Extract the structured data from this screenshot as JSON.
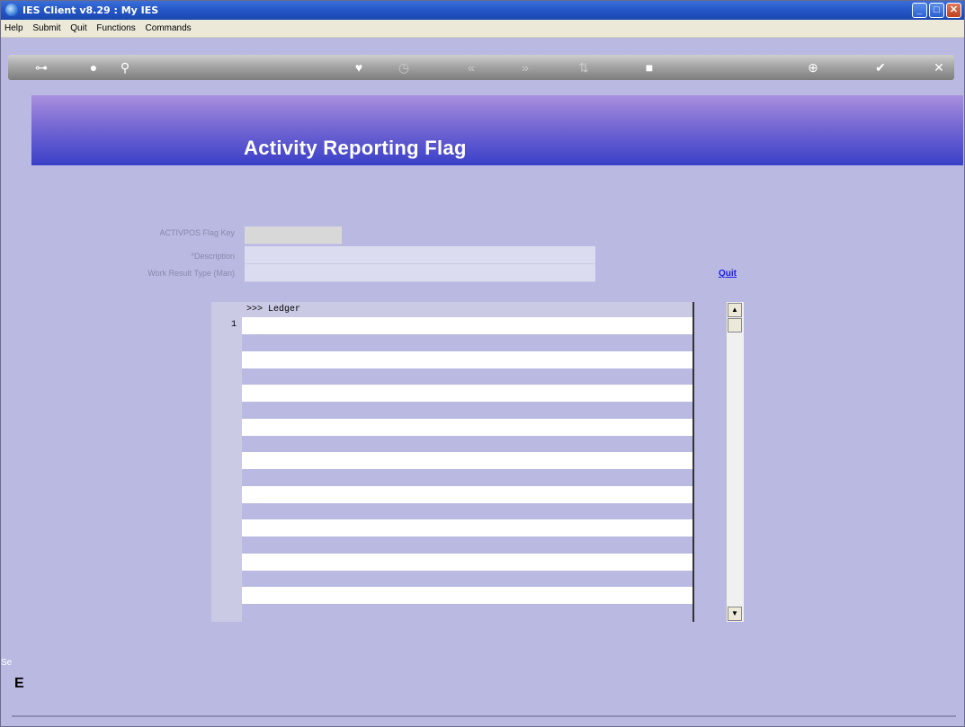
{
  "window": {
    "title": "IES Client v8.29 : My IES"
  },
  "menu": {
    "items": [
      "Help",
      "Submit",
      "Quit",
      "Functions",
      "Commands"
    ]
  },
  "page": {
    "title": "Activity Reporting Flag"
  },
  "form": {
    "key_label": "ACTIVPOS Flag Key",
    "description_label": "*Description",
    "work_result_label": "Work Result Type (Man)",
    "key_value": "",
    "description_value": "",
    "work_result_value": ""
  },
  "quit_label": "Quit",
  "grid": {
    "header": ">>> Ledger",
    "row_number": "1"
  },
  "side": {
    "label_top": "Se",
    "label_bottom": "E"
  }
}
